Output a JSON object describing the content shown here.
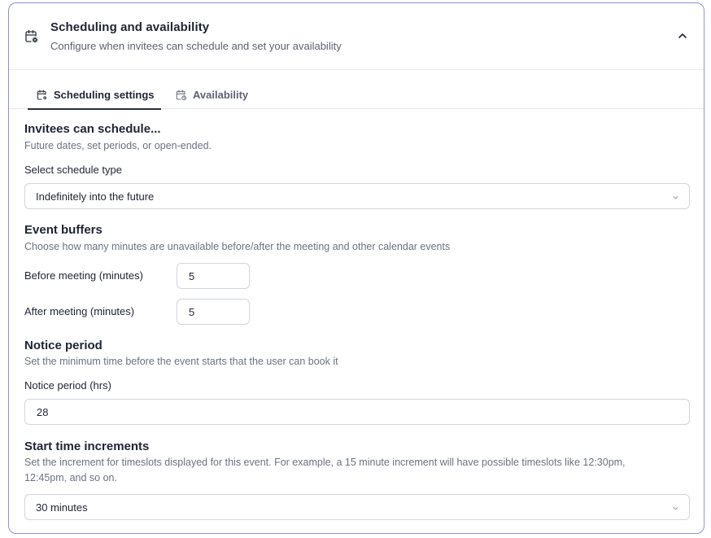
{
  "header": {
    "title": "Scheduling and availability",
    "subtitle": "Configure when invitees can schedule and set your availability",
    "icon": "calendar-gear-icon",
    "collapse_icon": "chevron-up-icon"
  },
  "tabs": [
    {
      "label": "Scheduling settings",
      "icon": "calendar-gear-icon",
      "active": true
    },
    {
      "label": "Availability",
      "icon": "calendar-clock-icon",
      "active": false
    }
  ],
  "invitees": {
    "title": "Invitees can schedule...",
    "description": "Future dates, set periods, or open-ended.",
    "select_label": "Select schedule type",
    "select_value": "Indefinitely into the future"
  },
  "buffers": {
    "title": "Event buffers",
    "description": "Choose how many minutes are unavailable before/after the meeting and other calendar events",
    "before_label": "Before meeting (minutes)",
    "before_value": "5",
    "after_label": "After meeting (minutes)",
    "after_value": "5"
  },
  "notice": {
    "title": "Notice period",
    "description": "Set the minimum time before the event starts that the user can book it",
    "field_label": "Notice period (hrs)",
    "field_value": "28"
  },
  "increments": {
    "title": "Start time increments",
    "description_line1": "Set the increment for timeslots displayed for this event. For example, a 15 minute increment will have possible timeslots like 12:30pm,",
    "description_line2": "12:45pm, and so on.",
    "select_value": "30 minutes"
  },
  "colors": {
    "card_border": "#8b8fe0",
    "text_primary": "#1f2433",
    "text_muted": "#6b7280"
  }
}
